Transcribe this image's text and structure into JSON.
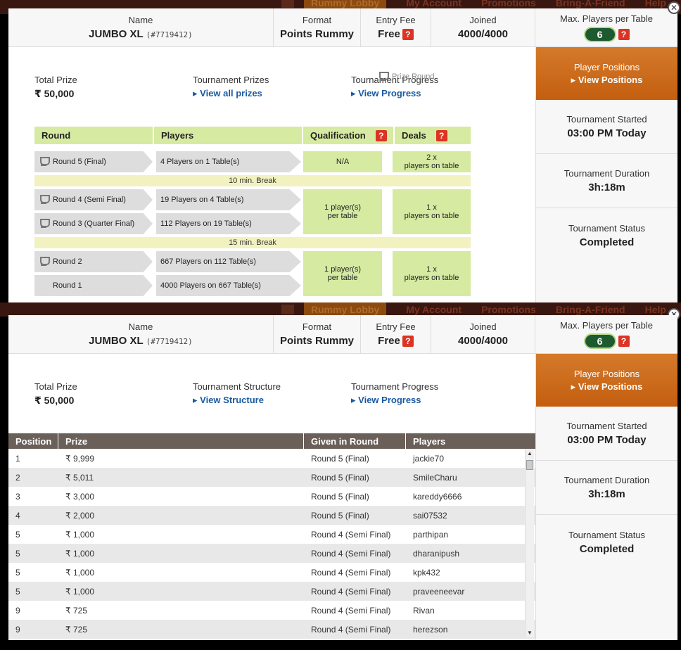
{
  "nav": {
    "lobby": "Rummy Lobby",
    "account": "My Account",
    "promotions": "Promotions",
    "friend": "Bring-A-Friend",
    "help": "Help"
  },
  "header": {
    "name_label": "Name",
    "name_value": "JUMBO XL",
    "name_id": "(#7719412)",
    "format_label": "Format",
    "format_value": "Points Rummy",
    "fee_label": "Entry Fee",
    "fee_value": "Free",
    "joined_label": "Joined",
    "joined_value": "4000/4000",
    "max_label": "Max. Players per Table",
    "max_value": "6",
    "help_glyph": "?"
  },
  "side": {
    "pp_line1": "Player Positions",
    "pp_line2": "View Positions",
    "started_label": "Tournament Started",
    "started_value": "03:00 PM Today",
    "duration_label": "Tournament Duration",
    "duration_value": "3h:18m",
    "status_label": "Tournament Status",
    "status_value": "Completed"
  },
  "top": {
    "total_label": "Total Prize",
    "total_value": "₹ 50,000",
    "prizes_label": "Tournament Prizes",
    "prizes_link": "View all prizes",
    "progress_label": "Tournament Progress",
    "progress_link": "View Progress",
    "prize_round": "Prize Round",
    "cols": [
      "Round",
      "Players",
      "Qualification",
      "Deals"
    ],
    "rounds": [
      {
        "name": "Round 5 (Final)",
        "players": "4 Players on 1 Table(s)"
      },
      {
        "name": "Round 4 (Semi Final)",
        "players": "19 Players on 4 Table(s)"
      },
      {
        "name": "Round 3 (Quarter Final)",
        "players": "112 Players on 19 Table(s)"
      },
      {
        "name": "Round 2",
        "players": "667 Players on 112 Table(s)"
      },
      {
        "name": "Round 1",
        "players": "4000 Players on 667 Table(s)"
      }
    ],
    "q1": "N/A",
    "d1a": "2 x",
    "d1b": "players on table",
    "break1": "10 min. Break",
    "q2a": "1 player(s)",
    "q2b": "per table",
    "d2a": "1 x",
    "d2b": "players on table",
    "break2": "15 min. Break",
    "q3a": "1 player(s)",
    "q3b": "per table",
    "d3a": "1 x",
    "d3b": "players on table"
  },
  "bottom": {
    "total_label": "Total Prize",
    "total_value": "₹ 50,000",
    "struct_label": "Tournament Structure",
    "struct_link": "View Structure",
    "progress_label": "Tournament Progress",
    "progress_link": "View Progress",
    "cols": [
      "Position",
      "Prize",
      "Given in Round",
      "Players"
    ],
    "rows": [
      {
        "pos": "1",
        "prize": "₹ 9,999",
        "round": "Round 5 (Final)",
        "player": "jackie70"
      },
      {
        "pos": "2",
        "prize": "₹ 5,011",
        "round": "Round 5 (Final)",
        "player": "SmileCharu"
      },
      {
        "pos": "3",
        "prize": "₹ 3,000",
        "round": "Round 5 (Final)",
        "player": "kareddy6666"
      },
      {
        "pos": "4",
        "prize": "₹ 2,000",
        "round": "Round 5 (Final)",
        "player": "sai07532"
      },
      {
        "pos": "5",
        "prize": "₹ 1,000",
        "round": "Round 4 (Semi Final)",
        "player": "parthipan"
      },
      {
        "pos": "5",
        "prize": "₹ 1,000",
        "round": "Round 4 (Semi Final)",
        "player": "dharanipush"
      },
      {
        "pos": "5",
        "prize": "₹ 1,000",
        "round": "Round 4 (Semi Final)",
        "player": "kpk432"
      },
      {
        "pos": "5",
        "prize": "₹ 1,000",
        "round": "Round 4 (Semi Final)",
        "player": "praveeneevar"
      },
      {
        "pos": "9",
        "prize": "₹ 725",
        "round": "Round 4 (Semi Final)",
        "player": "Rivan"
      },
      {
        "pos": "9",
        "prize": "₹ 725",
        "round": "Round 4 (Semi Final)",
        "player": "herezson"
      }
    ]
  }
}
